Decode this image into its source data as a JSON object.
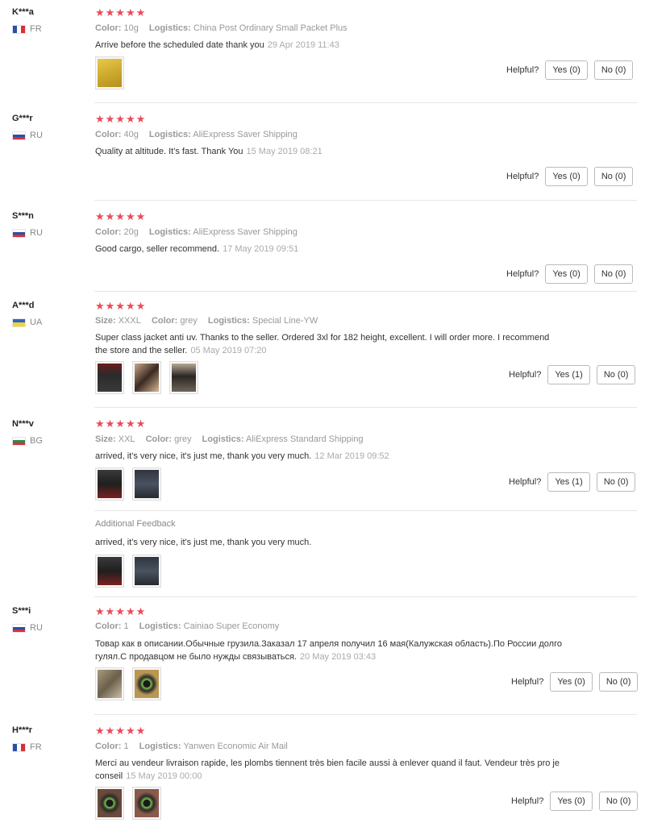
{
  "helpful_label": "Helpful?",
  "additional_feedback_label": "Additional Feedback",
  "star_rating": "★★★★★",
  "attr_labels": {
    "color": "Color:",
    "size": "Size:",
    "logistics": "Logistics:"
  },
  "reviews": [
    {
      "user": "K***a",
      "country": "FR",
      "color": "10g",
      "logistics": "China Post Ordinary Small Packet Plus",
      "text": "Arrive before the scheduled date thank you",
      "date": "29 Apr 2019 11:43",
      "yes": "Yes (0)",
      "no": "No (0)"
    },
    {
      "user": "G***r",
      "country": "RU",
      "color": "40g",
      "logistics": "AliExpress Saver Shipping",
      "text": "Quality at altitude. It's fast. Thank You",
      "date": "15 May 2019 08:21",
      "yes": "Yes (0)",
      "no": "No (0)"
    },
    {
      "user": "S***n",
      "country": "RU",
      "color": "20g",
      "logistics": "AliExpress Saver Shipping",
      "text": "Good cargo, seller recommend.",
      "date": "17 May 2019 09:51",
      "yes": "Yes (0)",
      "no": "No (0)"
    },
    {
      "user": "A***d",
      "country": "UA",
      "size": "XXXL",
      "color": "grey",
      "logistics": "Special Line-YW",
      "text_line1": "Super class jacket anti uv. Thanks to the seller. Ordered 3xl for 182 height, excellent. I will order more. I recommend",
      "text_line2": "the store and the seller.",
      "date": "05 May 2019 07:20",
      "yes": "Yes (1)",
      "no": "No (0)"
    },
    {
      "user": "N***v",
      "country": "BG",
      "size": "XXL",
      "color": "grey",
      "logistics": "AliExpress Standard Shipping",
      "text": "arrived, it's very nice, it's just me, thank you very much.",
      "date": "12 Mar 2019 09:52",
      "yes": "Yes (1)",
      "no": "No (0)",
      "additional_text": "arrived, it's very nice, it's just me, thank you very much."
    },
    {
      "user": "S***i",
      "country": "RU",
      "color": "1",
      "logistics": "Cainiao Super Economy",
      "text_line1": "Товар как в описании.Обычные грузила.Заказал 17 апреля получил 16 мая(Калужская область).По России долго",
      "text_line2": "гулял.С продавцом не было нужды связываться.",
      "date": "20 May 2019 03:43",
      "yes": "Yes (0)",
      "no": "No (0)"
    },
    {
      "user": "H***r",
      "country": "FR",
      "color": "1",
      "logistics": "Yanwen Economic Air Mail",
      "text_line1": "Merci au vendeur livraison rapide, les plombs tiennent très bien facile aussi à enlever quand il faut. Vendeur très pro je",
      "text_line2": "conseil",
      "date": "15 May 2019 00:00",
      "yes": "Yes (0)",
      "no": "No (0)"
    }
  ],
  "colors": {
    "star": "#e94b5a",
    "meta": "#999999",
    "separator": "#e6e6e6"
  }
}
